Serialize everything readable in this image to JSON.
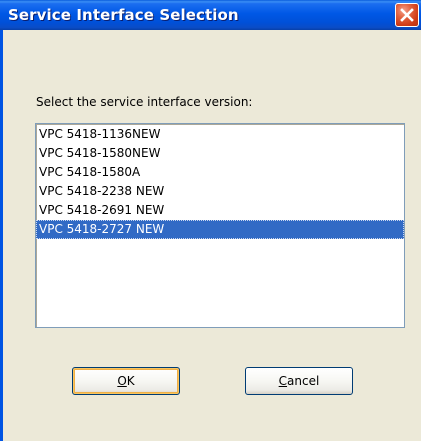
{
  "window": {
    "title": "Service Interface Selection"
  },
  "dialog": {
    "prompt": "Select the service interface version:",
    "items": [
      {
        "label": "VPC 5418-1136NEW",
        "selected": false
      },
      {
        "label": "VPC 5418-1580NEW",
        "selected": false
      },
      {
        "label": "VPC 5418-1580A",
        "selected": false
      },
      {
        "label": "VPC 5418-2238 NEW",
        "selected": false
      },
      {
        "label": "VPC 5418-2691 NEW",
        "selected": false
      },
      {
        "label": "VPC 5418-2727 NEW",
        "selected": true
      }
    ],
    "ok_mnemonic": "O",
    "ok_rest": "K",
    "cancel_mnemonic": "C",
    "cancel_rest": "ancel"
  },
  "colors": {
    "titlebar": "#0058e6",
    "selection": "#316ac5",
    "close_button": "#cf3b17",
    "dialog_bg": "#ece9d8"
  },
  "icons": {
    "close": "close-icon"
  }
}
